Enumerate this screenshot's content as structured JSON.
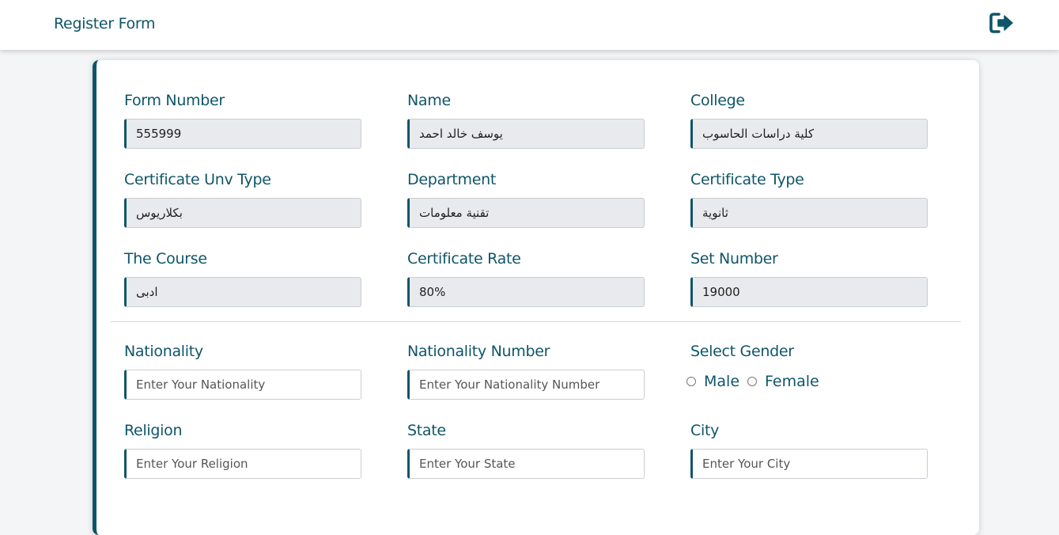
{
  "header": {
    "brand": "Register Form",
    "logout_icon": "logout-icon"
  },
  "colors": {
    "primary": "#0f5569",
    "readonly_bg": "#e8eaed",
    "page_bg": "#f4f5f7"
  },
  "readonly_fields": [
    {
      "label": "Form Number",
      "value": "555999"
    },
    {
      "label": "Name",
      "value": "يوسف خالد احمد"
    },
    {
      "label": "College",
      "value": "كلية دراسات الحاسوب"
    },
    {
      "label": "Certificate Unv Type",
      "value": "بكلاريوس"
    },
    {
      "label": "Department",
      "value": "تقنية معلومات"
    },
    {
      "label": "Certificate Type",
      "value": "ثانوية"
    },
    {
      "label": "The Course",
      "value": "ادبى"
    },
    {
      "label": "Certificate Rate",
      "value": "80%"
    },
    {
      "label": "Set Number",
      "value": "19000"
    }
  ],
  "editable_fields": {
    "nationality": {
      "label": "Nationality",
      "placeholder": "Enter Your Nationality"
    },
    "nationality_number": {
      "label": "Nationality Number",
      "placeholder": "Enter Your Nationality Number"
    },
    "religion": {
      "label": "Religion",
      "placeholder": "Enter Your Religion"
    },
    "state": {
      "label": "State",
      "placeholder": "Enter Your State"
    },
    "city": {
      "label": "City",
      "placeholder": "Enter Your City"
    }
  },
  "gender": {
    "label": "Select Gender",
    "options": [
      "Male",
      "Female"
    ]
  }
}
